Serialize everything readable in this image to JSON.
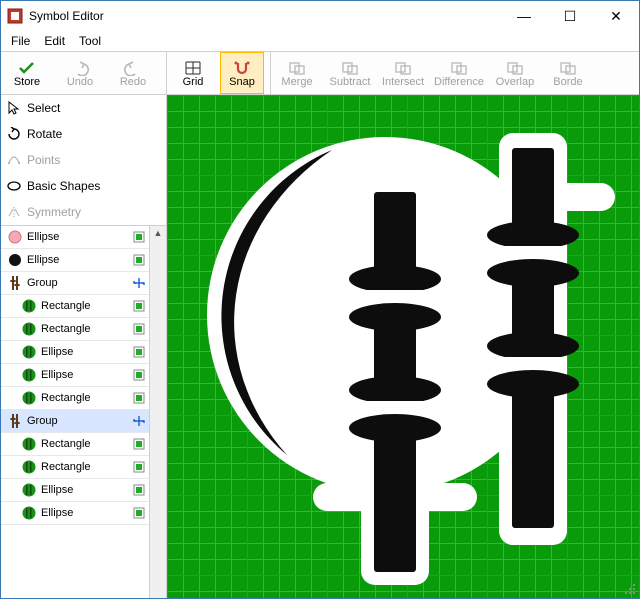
{
  "window": {
    "title": "Symbol Editor"
  },
  "win_buttons": {
    "min": "—",
    "max": "☐",
    "close": "✕"
  },
  "menu": {
    "file": "File",
    "edit": "Edit",
    "tool": "Tool"
  },
  "toolbar": {
    "store": {
      "label": "Store",
      "enabled": true,
      "icon": "check"
    },
    "undo": {
      "label": "Undo",
      "enabled": false,
      "icon": "undo"
    },
    "redo": {
      "label": "Redo",
      "enabled": false,
      "icon": "redo"
    },
    "grid": {
      "label": "Grid",
      "enabled": true,
      "icon": "grid"
    },
    "snap": {
      "label": "Snap",
      "enabled": true,
      "icon": "snap",
      "active": true
    },
    "merge": {
      "label": "Merge",
      "enabled": false,
      "icon": "merge"
    },
    "subtract": {
      "label": "Subtract",
      "enabled": false,
      "icon": "subtract"
    },
    "intersect": {
      "label": "Intersect",
      "enabled": false,
      "icon": "intersect"
    },
    "difference": {
      "label": "Difference",
      "enabled": false,
      "icon": "difference"
    },
    "overlap": {
      "label": "Overlap",
      "enabled": false,
      "icon": "overlap"
    },
    "border": {
      "label": "Borde",
      "enabled": false,
      "icon": "border"
    }
  },
  "tool_panel": [
    {
      "label": "Select",
      "enabled": true,
      "icon": "cursor"
    },
    {
      "label": "Rotate",
      "enabled": true,
      "icon": "rotate"
    },
    {
      "label": "Points",
      "enabled": false,
      "icon": "points"
    },
    {
      "label": "Basic Shapes",
      "enabled": true,
      "icon": "ellipse-outline"
    },
    {
      "label": "Symmetry",
      "enabled": false,
      "icon": "symmetry"
    }
  ],
  "shape_list": [
    {
      "label": "Ellipse",
      "depth": 0,
      "icon": "ellipse-pink",
      "badge": "green",
      "selected": false
    },
    {
      "label": "Ellipse",
      "depth": 0,
      "icon": "ellipse-black",
      "badge": "green",
      "selected": false
    },
    {
      "label": "Group",
      "depth": 0,
      "icon": "group-bars",
      "badge": "blue",
      "selected": false
    },
    {
      "label": "Rectangle",
      "depth": 1,
      "icon": "circle-bars",
      "badge": "green",
      "selected": false
    },
    {
      "label": "Rectangle",
      "depth": 1,
      "icon": "circle-bars",
      "badge": "green",
      "selected": false
    },
    {
      "label": "Ellipse",
      "depth": 1,
      "icon": "circle-bars",
      "badge": "green",
      "selected": false
    },
    {
      "label": "Ellipse",
      "depth": 1,
      "icon": "circle-bars",
      "badge": "green",
      "selected": false
    },
    {
      "label": "Rectangle",
      "depth": 1,
      "icon": "circle-bars",
      "badge": "green",
      "selected": false
    },
    {
      "label": "Group",
      "depth": 0,
      "icon": "group-bars",
      "badge": "blue",
      "selected": true
    },
    {
      "label": "Rectangle",
      "depth": 1,
      "icon": "circle-bars",
      "badge": "green",
      "selected": false
    },
    {
      "label": "Rectangle",
      "depth": 1,
      "icon": "circle-bars",
      "badge": "green",
      "selected": false
    },
    {
      "label": "Ellipse",
      "depth": 1,
      "icon": "circle-bars",
      "badge": "green",
      "selected": false
    },
    {
      "label": "Ellipse",
      "depth": 1,
      "icon": "circle-bars",
      "badge": "green",
      "selected": false
    }
  ],
  "colors": {
    "canvas_bg": "#0a9b0a",
    "accent": "#ffeec2"
  }
}
